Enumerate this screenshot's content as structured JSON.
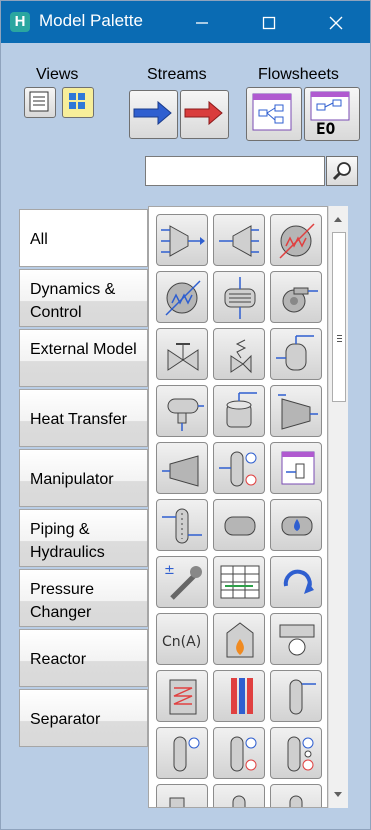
{
  "window": {
    "title": "Model Palette"
  },
  "toolbar": {
    "views_label": "Views",
    "streams_label": "Streams",
    "flowsheets_label": "Flowsheets",
    "eo_label": "EO"
  },
  "categories": [
    {
      "label": "All"
    },
    {
      "label": "Dynamics & Control"
    },
    {
      "label": "External Model"
    },
    {
      "label": "Heat Transfer"
    },
    {
      "label": "Manipulator"
    },
    {
      "label": "Piping & Hydraulics"
    },
    {
      "label": "Pressure Changer"
    },
    {
      "label": "Reactor"
    },
    {
      "label": "Separator"
    }
  ],
  "palette": {
    "tiles": [
      {
        "icon": "mixer-icon"
      },
      {
        "icon": "splitter-icon"
      },
      {
        "icon": "heater-icon"
      },
      {
        "icon": "cooler-icon"
      },
      {
        "icon": "heat-exchanger-icon"
      },
      {
        "icon": "pump-icon"
      },
      {
        "icon": "valve-icon"
      },
      {
        "icon": "relief-valve-icon"
      },
      {
        "icon": "vessel-icon"
      },
      {
        "icon": "horizontal-vessel-icon"
      },
      {
        "icon": "tank-icon"
      },
      {
        "icon": "compressor-icon"
      },
      {
        "icon": "expander-icon"
      },
      {
        "icon": "column-icon"
      },
      {
        "icon": "sub-flowsheet-icon"
      },
      {
        "icon": "packed-column-icon"
      },
      {
        "icon": "pipe-segment-icon"
      },
      {
        "icon": "drop-pipe-icon"
      },
      {
        "icon": "adjust-icon"
      },
      {
        "icon": "spreadsheet-icon"
      },
      {
        "icon": "recycle-icon"
      },
      {
        "icon": "component-splitter-icon",
        "text": "Cn(A)"
      },
      {
        "icon": "fired-heater-icon"
      },
      {
        "icon": "air-cooler-icon"
      },
      {
        "icon": "lng-exchanger-icon"
      },
      {
        "icon": "plate-exchanger-icon"
      },
      {
        "icon": "reboiled-absorber-icon"
      },
      {
        "icon": "refluxed-absorber-icon"
      },
      {
        "icon": "distillation-column-icon"
      },
      {
        "icon": "three-phase-column-icon"
      },
      {
        "icon": "partial-tile-1-icon"
      },
      {
        "icon": "partial-tile-2-icon"
      },
      {
        "icon": "partial-tile-3-icon"
      }
    ]
  },
  "colors": {
    "titlebar": "#0a6bb3",
    "background": "#b9cde5",
    "arrow_blue": "#2f5fd0",
    "arrow_red": "#d93c3c",
    "icon_red": "#e04040"
  }
}
